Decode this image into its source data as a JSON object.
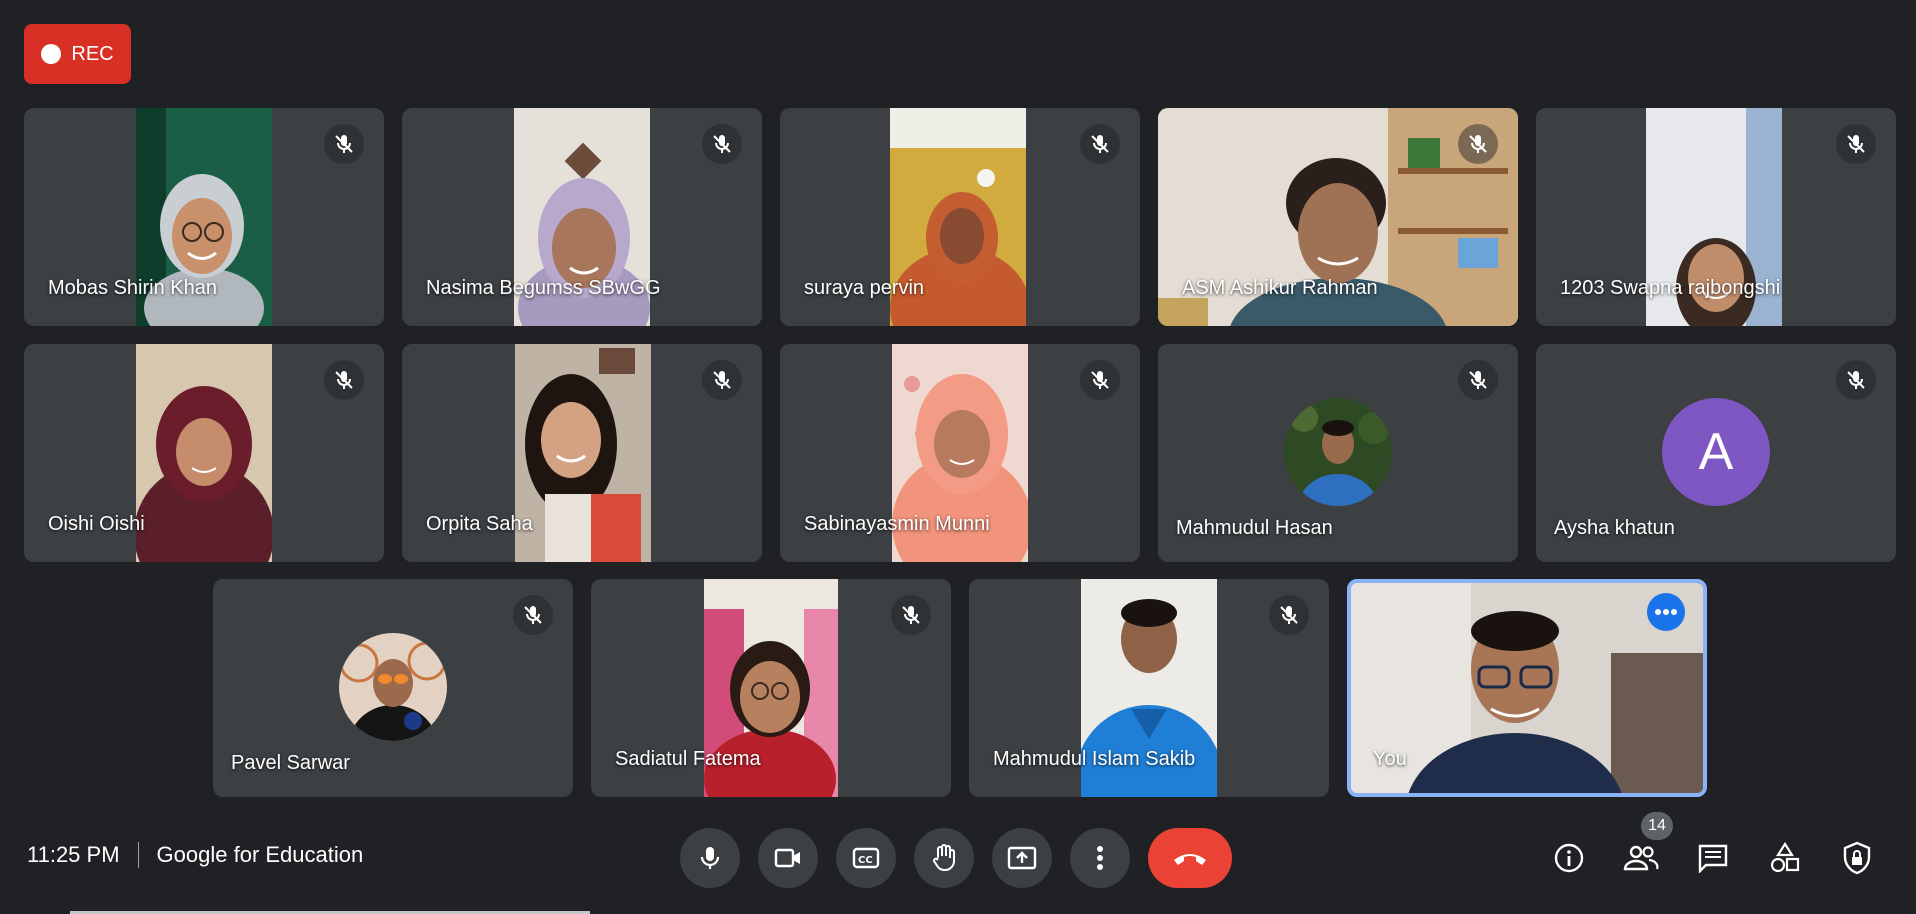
{
  "recording": {
    "label": "REC"
  },
  "participants": [
    {
      "name": "Mobas Shirin Khan",
      "muted": true,
      "video": "portrait",
      "bg": "#1b5e46"
    },
    {
      "name": "Nasima Begumss SBwGG",
      "muted": true,
      "video": "portrait",
      "bg": "#d8d3cf"
    },
    {
      "name": "suraya pervin",
      "muted": true,
      "video": "portrait",
      "bg": "#c9a13c"
    },
    {
      "name": "ASM Ashikur Rahman",
      "muted": true,
      "video": "wide",
      "bg": "#d9d2c8"
    },
    {
      "name": "1203 Swapna rajbongshi",
      "muted": true,
      "video": "portrait",
      "bg": "#e3e5ea"
    },
    {
      "name": "Oishi Oishi",
      "muted": true,
      "video": "portrait",
      "bg": "#c9b59c"
    },
    {
      "name": "Orpita Saha",
      "muted": true,
      "video": "portrait",
      "bg": "#8a7a6c"
    },
    {
      "name": "Sabinayasmin Munni",
      "muted": true,
      "video": "portrait",
      "bg": "#e8cfc5"
    },
    {
      "name": "Mahmudul Hasan",
      "muted": true,
      "video": "avatar-photo",
      "bg": "#2e4a25"
    },
    {
      "name": "Aysha khatun",
      "muted": true,
      "video": "avatar-letter",
      "letter": "A",
      "bg": "#7e57c2"
    },
    {
      "name": "Pavel Sarwar",
      "muted": true,
      "video": "avatar-photo",
      "bg": "#c9753f"
    },
    {
      "name": "Sadiatul Fatema",
      "muted": true,
      "video": "portrait",
      "bg": "#d24c7a"
    },
    {
      "name": "Mahmudul Islam Sakib",
      "muted": true,
      "video": "portrait",
      "bg": "#eceae6"
    },
    {
      "name": "You",
      "muted": false,
      "video": "wide",
      "bg": "#cfc9c2",
      "self": true
    }
  ],
  "footer": {
    "time": "11:25 PM",
    "meeting": "Google for Education",
    "participant_count": "14"
  },
  "controls": [
    "mic-icon",
    "camera-icon",
    "captions-icon",
    "raise-hand-icon",
    "present-icon",
    "more-options-icon",
    "end-call-icon"
  ],
  "right_controls": [
    "info-icon",
    "people-icon",
    "chat-icon",
    "activities-icon",
    "host-controls-icon"
  ],
  "colors": {
    "background": "#202124",
    "tile": "#3c4043",
    "end_call": "#ea4335",
    "rec": "#d93025",
    "self_border": "#8ab4f8"
  }
}
